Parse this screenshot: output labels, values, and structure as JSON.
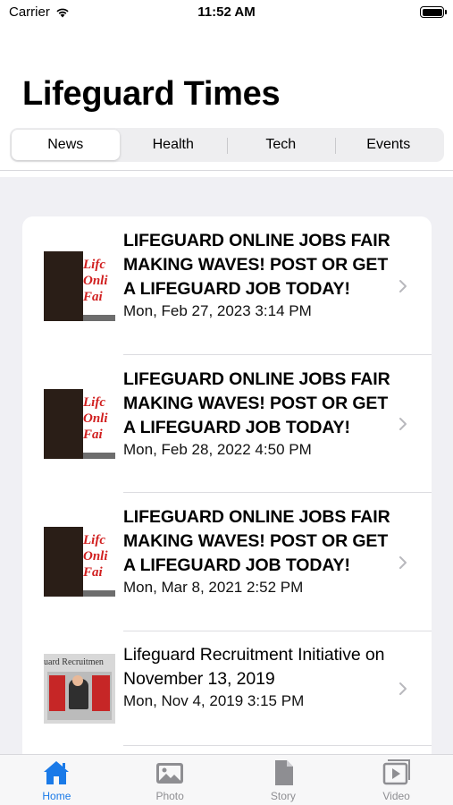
{
  "status_bar": {
    "carrier": "Carrier",
    "time": "11:52 AM"
  },
  "header": {
    "title": "Lifeguard Times"
  },
  "segments": [
    {
      "label": "News",
      "selected": true
    },
    {
      "label": "Health",
      "selected": false
    },
    {
      "label": "Tech",
      "selected": false
    },
    {
      "label": "Events",
      "selected": false
    }
  ],
  "articles": [
    {
      "title": "LIFEGUARD ONLINE JOBS FAIR MAKING WAVES! POST OR GET A LIFEGUARD JOB TODAY!",
      "date": "Mon, Feb 27, 2023 3:14 PM",
      "thumb_text": "Lifc Onli Fai"
    },
    {
      "title": "LIFEGUARD ONLINE JOBS FAIR MAKING WAVES! POST OR GET A LIFEGUARD JOB TODAY!",
      "date": "Mon, Feb 28, 2022 4:50 PM",
      "thumb_text": "Lifc Onli Fai"
    },
    {
      "title": "LIFEGUARD ONLINE JOBS FAIR MAKING WAVES! POST OR GET A LIFEGUARD JOB TODAY!",
      "date": "Mon, Mar 8, 2021 2:52 PM",
      "thumb_text": "Lifc Onli Fai"
    },
    {
      "title": "Lifeguard Recruitment Initiative on November 13, 2019",
      "date": "Mon, Nov 4, 2019 3:15 PM",
      "thumb_text": "uard Recruitmen"
    }
  ],
  "tab_bar": {
    "items": [
      {
        "label": "Home",
        "icon": "home-icon",
        "active": true
      },
      {
        "label": "Photo",
        "icon": "photo-icon",
        "active": false
      },
      {
        "label": "Story",
        "icon": "story-icon",
        "active": false
      },
      {
        "label": "Video",
        "icon": "video-icon",
        "active": false
      }
    ],
    "active_color": "#1a7ae8",
    "inactive_color": "#8e8e92"
  }
}
